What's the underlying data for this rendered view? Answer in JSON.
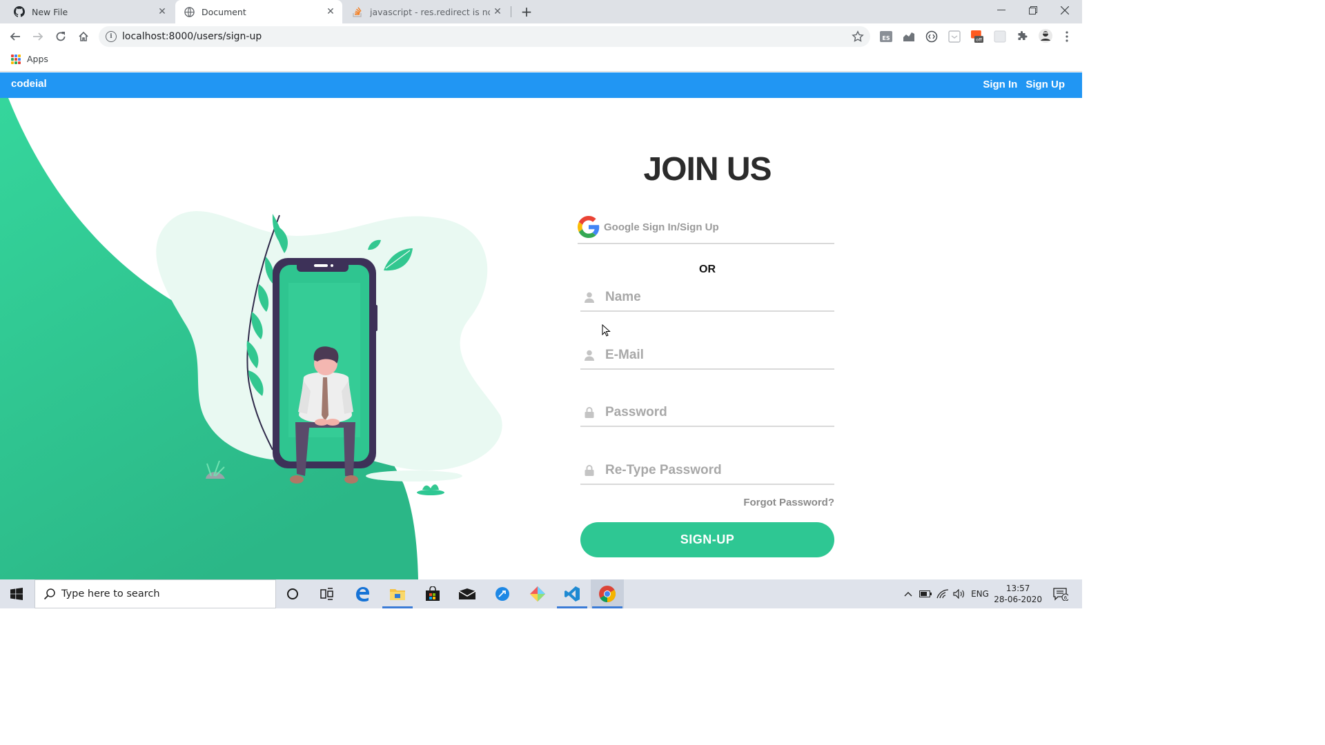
{
  "browser": {
    "tabs": [
      {
        "title": "New File",
        "icon": "github-icon"
      },
      {
        "title": "Document",
        "icon": "globe-icon"
      },
      {
        "title": "javascript - res.redirect is not a fu",
        "icon": "stackoverflow-icon"
      }
    ],
    "new_tab": "+",
    "url": "localhost:8000/users/sign-up",
    "bookmarks": {
      "apps_label": "Apps"
    },
    "extensions": [
      "es-extension-icon",
      "chart-extension-icon",
      "code-extension-icon",
      "doc-extension-icon",
      "off-extension-icon",
      "blank-extension-icon",
      "puzzle-icon",
      "profile-avatar-icon"
    ],
    "off_badge": "off"
  },
  "site": {
    "brand": "codeial",
    "nav": {
      "sign_in": "Sign In",
      "sign_up": "Sign Up"
    },
    "accent": "#2196f3",
    "green": "#2ec793"
  },
  "form": {
    "heading": "JOIN US",
    "google_label": "Google Sign In/Sign Up",
    "or_label": "OR",
    "fields": {
      "name": {
        "placeholder": "Name",
        "value": ""
      },
      "email": {
        "placeholder": "E-Mail",
        "value": ""
      },
      "password": {
        "placeholder": "Password",
        "value": ""
      },
      "retype": {
        "placeholder": "Re-Type Password",
        "value": ""
      }
    },
    "forgot": "Forgot Password?",
    "submit": "SIGN-UP"
  },
  "taskbar": {
    "search_placeholder": "Type here to search",
    "language": "ENG",
    "time": "13:57",
    "date": "28-06-2020",
    "notifications": "6"
  }
}
